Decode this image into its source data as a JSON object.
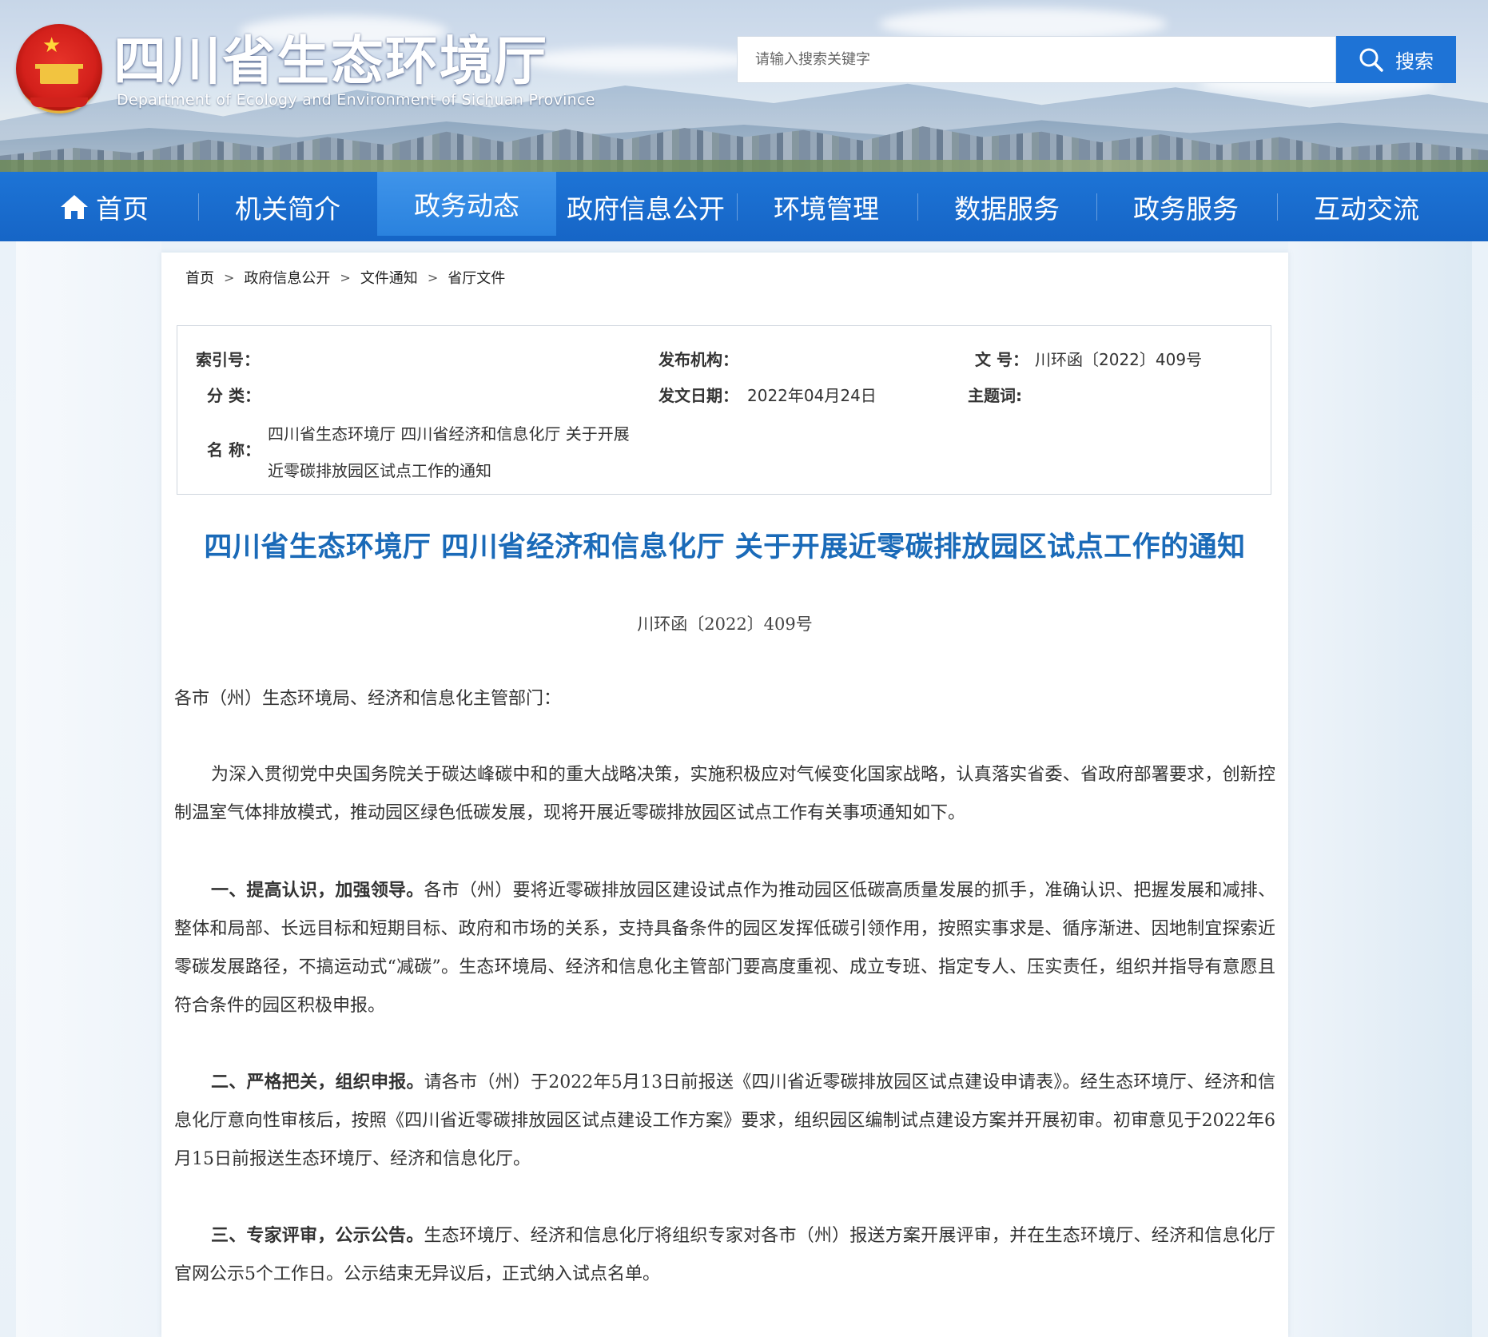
{
  "header": {
    "title": "四川省生态环境厅",
    "subtitle": "Department of Ecology and Environment of Sichuan Province",
    "search_placeholder": "请输入搜索关键字",
    "search_button": "搜索"
  },
  "nav": {
    "items": [
      {
        "label": "首页"
      },
      {
        "label": "机关简介"
      },
      {
        "label": "政务动态"
      },
      {
        "label": "政府信息公开"
      },
      {
        "label": "环境管理"
      },
      {
        "label": "数据服务"
      },
      {
        "label": "政务服务"
      },
      {
        "label": "互动交流"
      }
    ],
    "active": "政务动态"
  },
  "breadcrumb": {
    "items": [
      "首页",
      "政府信息公开",
      "文件通知",
      "省厅文件"
    ],
    "separator": ">"
  },
  "info": {
    "index_label": "索引号：",
    "index_value": "",
    "publisher_label": "发布机构：",
    "publisher_value": "",
    "docno_label": "文  号：",
    "docno_value": "川环函〔2022〕409号",
    "category_label": "分  类：",
    "category_value": "",
    "date_label": "发文日期：",
    "date_value": "2022年04月24日",
    "topic_label": "主题词:",
    "topic_value": "",
    "name_label": "名  称：",
    "name_value": "四川省生态环境厅 四川省经济和信息化厅 关于开展近零碳排放园区试点工作的通知"
  },
  "document": {
    "title": "四川省生态环境厅 四川省经济和信息化厅 关于开展近零碳排放园区试点工作的通知",
    "number": "川环函〔2022〕409号",
    "salutation": "各市（州）生态环境局、经济和信息化主管部门：",
    "intro": "为深入贯彻党中央国务院关于碳达峰碳中和的重大战略决策，实施积极应对气候变化国家战略，认真落实省委、省政府部署要求，创新控制温室气体排放模式，推动园区绿色低碳发展，现将开展近零碳排放园区试点工作有关事项通知如下。",
    "sections": [
      {
        "lead": "一、提高认识，加强领导。",
        "text": "各市（州）要将近零碳排放园区建设试点作为推动园区低碳高质量发展的抓手，准确认识、把握发展和减排、整体和局部、长远目标和短期目标、政府和市场的关系，支持具备条件的园区发挥低碳引领作用，按照实事求是、循序渐进、因地制宜探索近零碳发展路径，不搞运动式“减碳”。生态环境局、经济和信息化主管部门要高度重视、成立专班、指定专人、压实责任，组织并指导有意愿且符合条件的园区积极申报。"
      },
      {
        "lead": "二、严格把关，组织申报。",
        "text": "请各市（州）于2022年5月13日前报送《四川省近零碳排放园区试点建设申请表》。经生态环境厅、经济和信息化厅意向性审核后，按照《四川省近零碳排放园区试点建设工作方案》要求，组织园区编制试点建设方案并开展初审。初审意见于2022年6月15日前报送生态环境厅、经济和信息化厅。"
      },
      {
        "lead": "三、专家评审，公示公告。",
        "text": "生态环境厅、经济和信息化厅将组织专家对各市（州）报送方案开展评审，并在生态环境厅、经济和信息化厅官网公示5个工作日。公示结束无异议后，正式纳入试点名单。"
      }
    ]
  },
  "colors": {
    "nav_bg": "#1d74d6",
    "title_blue": "#1a6ab8",
    "search_button": "#1e73d6"
  }
}
